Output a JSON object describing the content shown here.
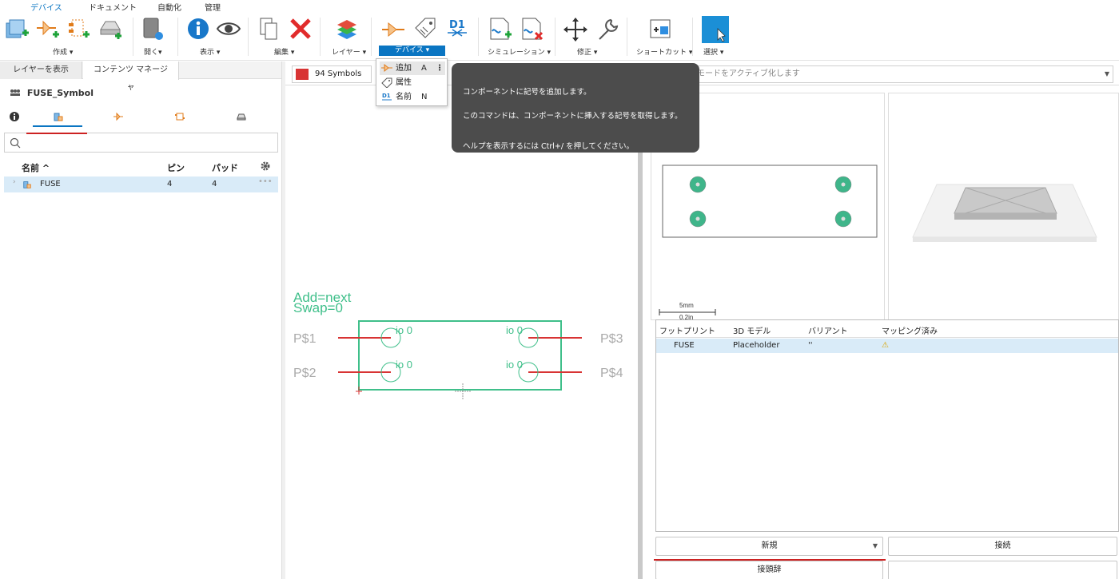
{
  "ribbon": {
    "tabs": [
      "デバイス",
      "ドキュメント",
      "自動化",
      "管理"
    ],
    "groups": {
      "create": "作成 ▾",
      "open": "開く▾",
      "view": "表示 ▾",
      "edit": "編集 ▾",
      "layer": "レイヤー ▾",
      "device": "デバイス ▾",
      "simulation": "シミュレーション ▾",
      "modify": "修正 ▾",
      "shortcut": "ショートカット ▾",
      "select": "選択 ▾"
    },
    "accent": "#0a75c2"
  },
  "left_panel": {
    "tabs": [
      "レイヤーを表示",
      "コンテンツ マネージャ"
    ],
    "title": "FUSE_Symbol",
    "search_placeholder": "",
    "columns": [
      "名前 ^",
      "ピン",
      "パッド"
    ],
    "rows": [
      {
        "name": "FUSE",
        "pins": "4",
        "pads": "4"
      }
    ]
  },
  "toolbar2": {
    "symbol_select": "94 Symbols",
    "command_placeholder": "モードをアクティブ化します"
  },
  "dropdown": {
    "items": [
      {
        "label": "追加",
        "key": "A"
      },
      {
        "label": "属性",
        "key": ""
      },
      {
        "label": "名前",
        "key": "N"
      }
    ]
  },
  "tooltip": {
    "line1": "コンポーネントに記号を追加します。",
    "line2": "このコマンドは、コンポーネントに挿入する記号を取得します。",
    "line3": "ヘルプを表示するには Ctrl+/ を押してください。"
  },
  "canvas": {
    "text_add": "Add=next",
    "text_swap": "Swap=0",
    "pins": [
      "P$1",
      "P$2",
      "P$3",
      "P$4"
    ],
    "pad_label": "io 0"
  },
  "right_panel": {
    "scale_label_top": "5mm",
    "scale_label_bottom": "0.2in",
    "grid_columns": [
      "フットプリント",
      "3D モデル",
      "バリアント",
      "マッピング済み"
    ],
    "grid_rows": [
      {
        "footprint": "FUSE",
        "model": "Placeholder",
        "variant": "''",
        "mapped": "⚠"
      }
    ],
    "buttons": {
      "new": "新規",
      "connect": "接続",
      "prefix": "接頭辞"
    }
  }
}
